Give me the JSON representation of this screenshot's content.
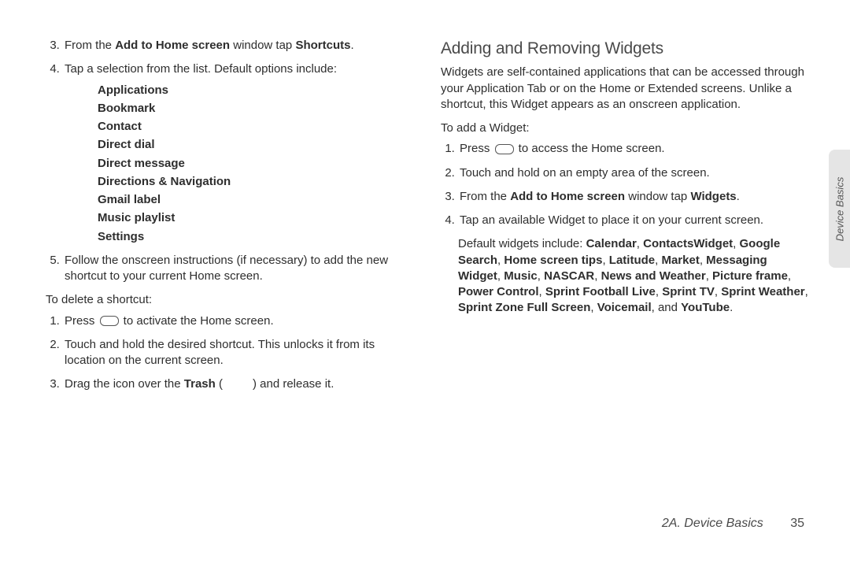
{
  "left": {
    "step3_a": "From the ",
    "step3_b": "Add to Home screen",
    "step3_c": " window tap ",
    "step3_d": "Shortcuts",
    "step3_e": ".",
    "step4": "Tap a selection from the list. Default options include:",
    "options": {
      "o1": "Applications",
      "o2": "Bookmark",
      "o3": "Contact",
      "o4": "Direct dial",
      "o5": "Direct message",
      "o6": "Directions & Navigation",
      "o7": "Gmail label",
      "o8": "Music playlist",
      "o9": "Settings"
    },
    "step5": "Follow the onscreen instructions (if necessary) to add the new shortcut to your current Home screen.",
    "delete_head": "To delete a shortcut:",
    "d1_a": "Press ",
    "d1_b": " to activate the Home screen.",
    "d2": "Touch and hold the desired shortcut. This unlocks it from its location on the current screen.",
    "d3_a": "Drag the icon over the ",
    "d3_b": "Trash",
    "d3_c": " (",
    "d3_d": ") and release it."
  },
  "right": {
    "title": "Adding and Removing Widgets",
    "intro": "Widgets are self-contained applications that can be accessed through your Application Tab or on the Home or Extended screens. Unlike a shortcut, this Widget appears as an onscreen application.",
    "add_head": "To add a Widget:",
    "a1_a": "Press ",
    "a1_b": " to access the Home screen.",
    "a2": "Touch and hold on an empty area of the screen.",
    "a3_a": "From the ",
    "a3_b": "Add to Home screen",
    "a3_c": " window tap ",
    "a3_d": "Widgets",
    "a3_e": ".",
    "a4": "Tap an available Widget to place it on your current screen.",
    "defaults_a": "Default widgets include: ",
    "w1": "Calendar",
    "w2": "ContactsWidget",
    "w3": "Google Search",
    "w4": "Home screen tips",
    "w5": "Latitude",
    "w6": "Market",
    "w7": "Messaging Widget",
    "w8": "Music",
    "w9": "NASCAR",
    "w10": "News and Weather",
    "w11": "Picture frame",
    "w12": "Power Control",
    "w13": "Sprint Football Live",
    "w14": "Sprint TV",
    "w15": "Sprint Weather",
    "w16": "Sprint Zone Full Screen",
    "w17": "Voicemail",
    "w_and": ", and ",
    "w18": "YouTube",
    "w_period": "."
  },
  "tab_label": "Device Basics",
  "footer_section": "2A. Device Basics",
  "footer_page": "35"
}
